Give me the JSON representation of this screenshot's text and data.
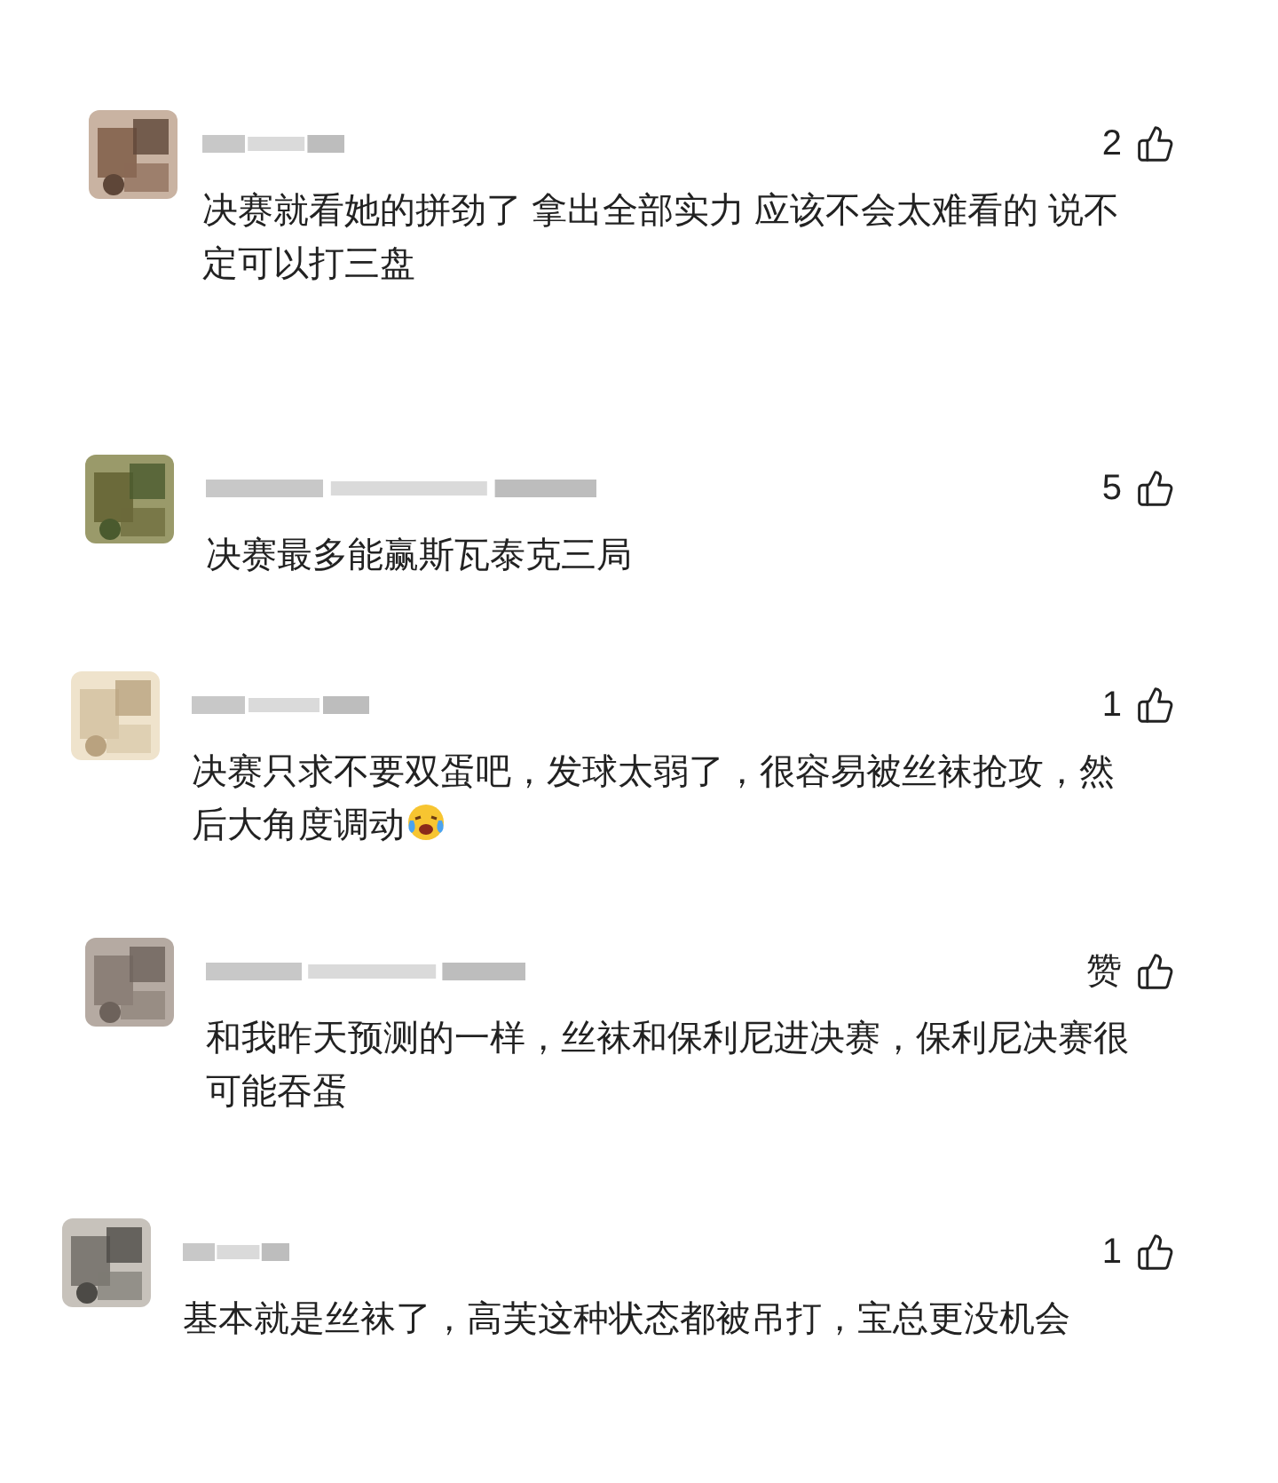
{
  "comments": [
    {
      "likes": "2",
      "text": "决赛就看她的拼劲了 拿出全部实力 应该不会太难看的 说不定可以打三盘",
      "emoji": false
    },
    {
      "likes": "5",
      "text": "决赛最多能赢斯瓦泰克三局",
      "emoji": false
    },
    {
      "likes": "1",
      "text": "决赛只求不要双蛋吧，发球太弱了，很容易被丝袜抢攻，然后大角度调动",
      "emoji": true
    },
    {
      "likes": "赞",
      "text": "和我昨天预测的一样，丝袜和保利尼进决赛，保利尼决赛很可能吞蛋",
      "emoji": false
    },
    {
      "likes": "1",
      "text": "基本就是丝袜了，高芙这种状态都被吊打，宝总更没机会",
      "emoji": false
    }
  ]
}
